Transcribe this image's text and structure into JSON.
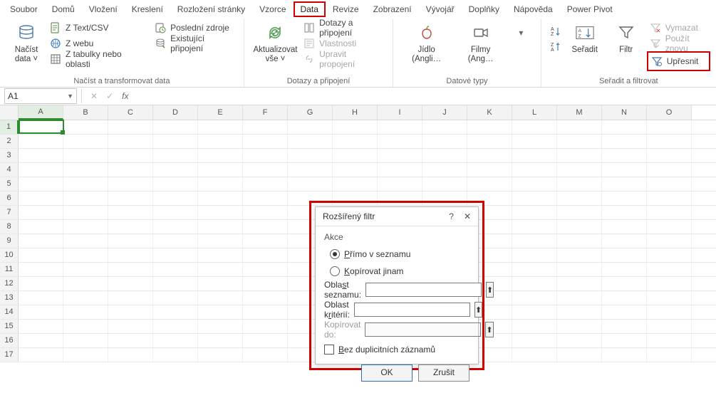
{
  "menu": {
    "items": [
      "Soubor",
      "Domů",
      "Vložení",
      "Kreslení",
      "Rozložení stránky",
      "Vzorce",
      "Data",
      "Revize",
      "Zobrazení",
      "Vývojář",
      "Doplňky",
      "Nápověda",
      "Power Pivot"
    ],
    "active_index": 6
  },
  "ribbon": {
    "group1": {
      "load_label_line1": "Načíst",
      "load_label_line2": "data ˅",
      "items": [
        "Z Text/CSV",
        "Z webu",
        "Z tabulky nebo oblasti",
        "Poslední zdroje",
        "Existující připojení"
      ],
      "group_label": "Načíst a transformovat data"
    },
    "group2": {
      "refresh_line1": "Aktualizovat",
      "refresh_line2": "vše ˅",
      "items": [
        "Dotazy a připojení",
        "Vlastnosti",
        "Upravit propojení"
      ],
      "group_label": "Dotazy a připojení"
    },
    "group3": {
      "items": [
        "Jídlo (Angli…",
        "Filmy (Ang…"
      ],
      "dropdown": "˅",
      "group_label": "Datové typy"
    },
    "group4": {
      "az": "A→Z",
      "za": "Z→A",
      "sort_label": "Seřadit",
      "filter_label": "Filtr",
      "clear": "Vymazat",
      "reapply": "Použít znovu",
      "advanced": "Upřesnit",
      "group_label": "Seřadit a filtrovat"
    }
  },
  "fx": {
    "namebox": "A1",
    "fx_symbol": "fx",
    "cancel": "✕",
    "confirm": "✓"
  },
  "grid": {
    "columns": [
      "A",
      "B",
      "C",
      "D",
      "E",
      "F",
      "G",
      "H",
      "I",
      "J",
      "K",
      "L",
      "M",
      "N",
      "O"
    ],
    "rows": [
      "1",
      "2",
      "3",
      "4",
      "5",
      "6",
      "7",
      "8",
      "9",
      "10",
      "11",
      "12",
      "13",
      "14",
      "15",
      "16",
      "17"
    ],
    "active_col_index": 0,
    "active_row_index": 0
  },
  "dialog": {
    "title": "Rozšířený filtr",
    "help": "?",
    "close": "✕",
    "group_action": "Akce",
    "radio1": "Přímo v seznamu",
    "radio1_key": "P",
    "radio2": "Kopírovat jinam",
    "radio2_key": "K",
    "field_list": "Oblast seznamu:",
    "field_list_key": "s",
    "field_crit": "Oblast kritérií:",
    "field_crit_key": "r",
    "field_copy": "Kopírovat do:",
    "checkbox": "Bez duplicitních záznamů",
    "checkbox_key": "B",
    "ok": "OK",
    "cancel": "Zrušit",
    "ref_glyph": "⬆",
    "list_value": "",
    "crit_value": "",
    "copy_value": ""
  }
}
